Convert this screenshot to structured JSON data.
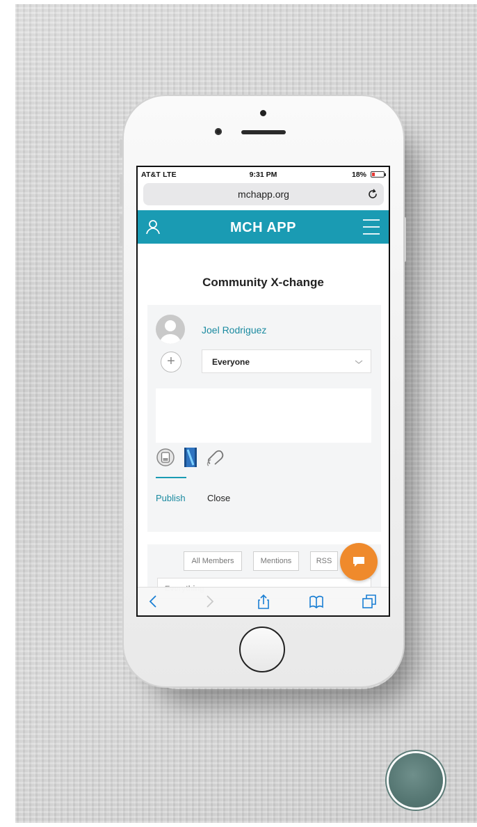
{
  "status_bar": {
    "carrier": "AT&T  LTE",
    "time": "9:31 PM",
    "battery": "18%"
  },
  "browser": {
    "url": "mchapp.org"
  },
  "app": {
    "title": "MCH APP"
  },
  "page": {
    "title": "Community X-change"
  },
  "composer": {
    "author": "Joel Rodriguez",
    "audience": "Everyone",
    "add_symbol": "+",
    "publish_label": "Publish",
    "close_label": "Close"
  },
  "feed": {
    "filters": [
      "All Members",
      "Mentions",
      "RSS"
    ],
    "scope": "Everything"
  },
  "colors": {
    "header": "#1a9bb3",
    "link": "#1a8aa0",
    "fab": "#ef8a2c"
  },
  "icons": {
    "header_left": "user-icon",
    "header_right": "menu-icon",
    "attachments": [
      "photo-icon",
      "video-icon",
      "link-icon"
    ],
    "toolbar": [
      "back-icon",
      "forward-icon",
      "share-icon",
      "bookmarks-icon",
      "tabs-icon"
    ]
  }
}
